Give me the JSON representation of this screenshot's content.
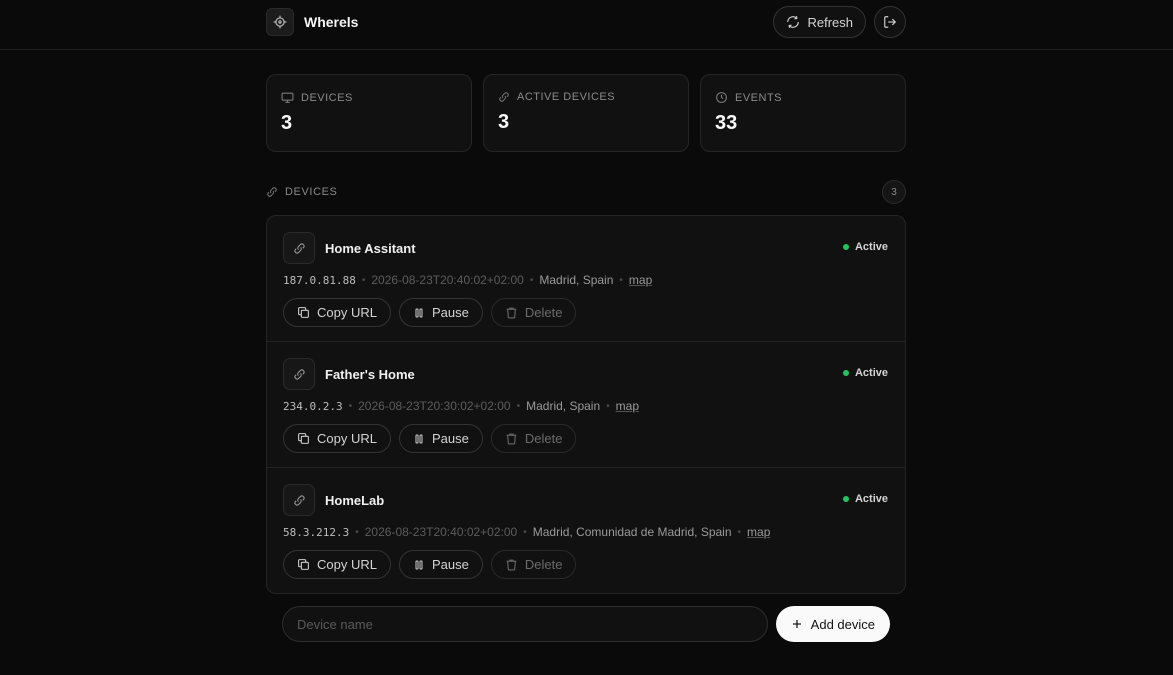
{
  "app": {
    "name": "Wherels",
    "logo_icon": "crosshair-icon"
  },
  "header": {
    "refresh_label": "Refresh",
    "refresh_icon": "refresh-icon",
    "logout_icon": "logout-icon"
  },
  "stats": [
    {
      "label": "DEVICES",
      "value": "3",
      "icon": "monitor-icon"
    },
    {
      "label": "ACTIVE DEVICES",
      "value": "3",
      "icon": "link-icon"
    },
    {
      "label": "EVENTS",
      "value": "33",
      "icon": "clock-icon"
    }
  ],
  "devices_section": {
    "title": "DEVICES",
    "count": "3"
  },
  "devices": [
    {
      "name": "Home Assitant",
      "status": "Active",
      "ip": "187.0.81.88",
      "timestamp": "2026-08-23T20:40:02+02:00",
      "location": "Madrid, Spain",
      "map_label": "map",
      "actions": {
        "copy": "Copy URL",
        "pause": "Pause",
        "delete": "Delete"
      }
    },
    {
      "name": "Father's Home",
      "status": "Active",
      "ip": "234.0.2.3",
      "timestamp": "2026-08-23T20:30:02+02:00",
      "location": "Madrid, Spain",
      "map_label": "map",
      "actions": {
        "copy": "Copy URL",
        "pause": "Pause",
        "delete": "Delete"
      }
    },
    {
      "name": "HomeLab",
      "status": "Active",
      "ip": "58.3.212.3",
      "timestamp": "2026-08-23T20:40:02+02:00",
      "location": "Madrid, Comunidad de Madrid, Spain",
      "map_label": "map",
      "actions": {
        "copy": "Copy URL",
        "pause": "Pause",
        "delete": "Delete"
      }
    }
  ],
  "add_device": {
    "placeholder": "Device name",
    "value": "",
    "button_label": "Add device"
  },
  "colors": {
    "background": "#0a0a0a",
    "card": "#111112",
    "status_active": "#22c55e",
    "primary_button": "#fafafa"
  }
}
